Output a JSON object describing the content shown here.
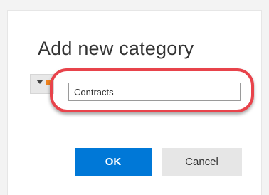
{
  "dialog": {
    "title": "Add new category",
    "color_picker": {
      "icon": "dropdown-arrow-icon",
      "selected_color": "#f0831e"
    },
    "name_field": {
      "value": "Contracts"
    },
    "highlight_color": "#e8434b",
    "buttons": {
      "ok_label": "OK",
      "cancel_label": "Cancel"
    },
    "accent_color": "#0078d7"
  }
}
